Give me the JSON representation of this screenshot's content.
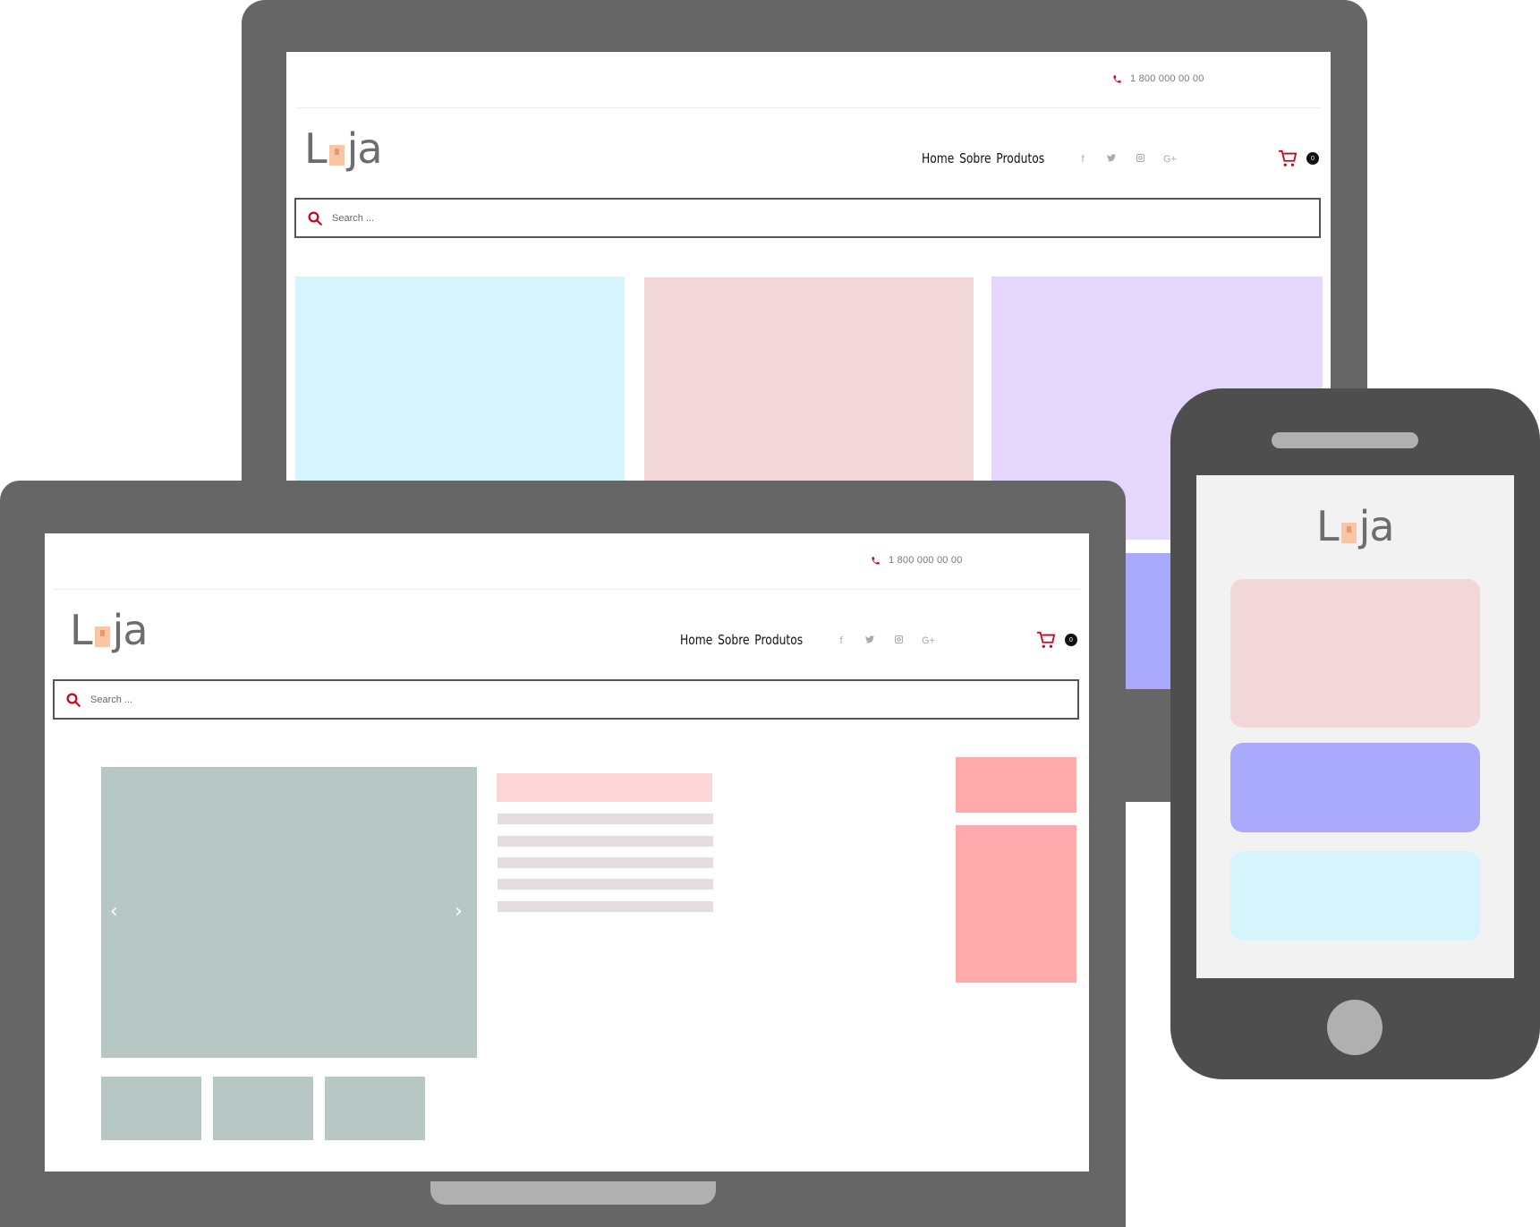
{
  "site": {
    "phone_number": "1 800 000 00 00",
    "logo_left": "L",
    "logo_right": "ja",
    "nav": [
      "Home",
      "Sobre",
      "Produtos"
    ],
    "social": [
      "f",
      "t",
      "ig",
      "G+"
    ],
    "cart_count": "0",
    "search_placeholder": "Search ..."
  },
  "colors": {
    "device_frame": "#666666",
    "phone_frame": "#4e4e4e",
    "accent_red": "#d0021b",
    "tile_cyan": "#d6f4fc",
    "tile_pink": "#f2d7d8",
    "tile_lavender": "#e5d6fc",
    "tile_periwinkle": "#aaaafc",
    "gallery_gray": "#b7c7c3",
    "promo_red": "#fea9ab"
  }
}
